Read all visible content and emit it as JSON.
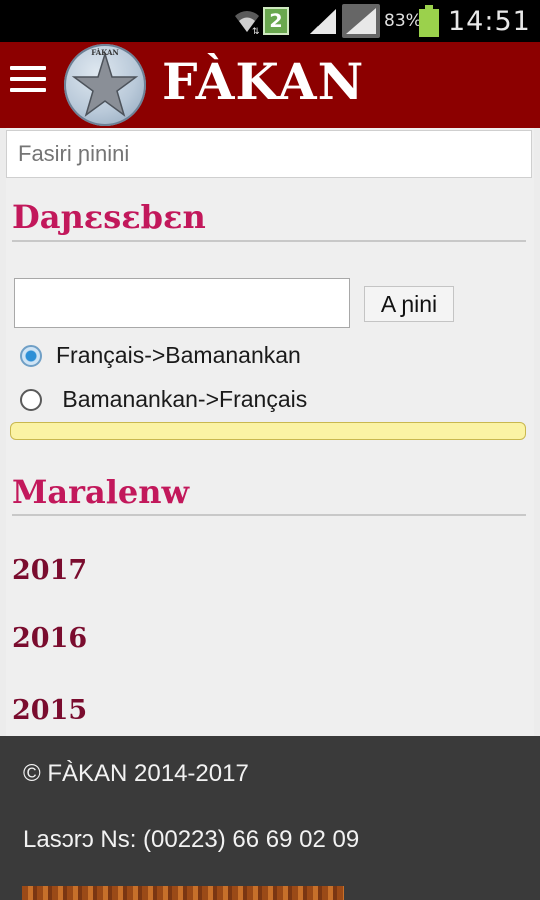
{
  "status_bar": {
    "notification_count": "2",
    "battery_percent": "83%",
    "time": "14:51",
    "icons": [
      "wifi-icon",
      "signal-icon",
      "battery-icon"
    ]
  },
  "header": {
    "brand": "FÀKAN",
    "logo_text": "FÀKAN",
    "background": "#8c0000"
  },
  "search": {
    "placeholder": "Fasiri ɲinini"
  },
  "dictionary": {
    "title": "Daɲɛsɛbɛn",
    "input_value": "",
    "button_label": "A ɲini",
    "options": [
      {
        "label": "Français->Bamanankan",
        "checked": true
      },
      {
        "label": " Bamanankan->Français",
        "checked": false
      }
    ]
  },
  "archives": {
    "title": "Maralenw",
    "years": [
      "2017",
      "2016",
      "2015"
    ]
  },
  "footer": {
    "copyright": "© FÀKAN 2014-2017",
    "contact": "Lasɔrɔ Ns: (00223) 66 69 02 09"
  },
  "colors": {
    "accent": "#c2185b",
    "year_link": "#7a0c2e"
  }
}
